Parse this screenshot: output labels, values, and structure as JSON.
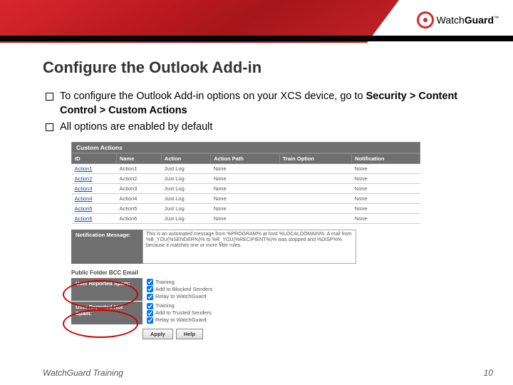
{
  "brand": {
    "pre": "Watch",
    "post": "Guard",
    "tm": "™"
  },
  "slide": {
    "title": "Configure the Outlook Add-in",
    "bullets": {
      "b1_pre": "To configure the Outlook Add-in options on your XCS device, go to ",
      "b1_bold": "Security > Content Control > Custom Actions",
      "b2": "All options are enabled by default"
    }
  },
  "panel": {
    "section_title": "Custom Actions",
    "headers": {
      "id": "ID",
      "name": "Name",
      "action": "Action",
      "path": "Action Path",
      "train": "Train Option",
      "notif": "Notification"
    },
    "rows": [
      {
        "id": "Action1",
        "name": "Action1",
        "action": "Just Log",
        "path": "None",
        "train": "",
        "notif": "None"
      },
      {
        "id": "Action2",
        "name": "Action2",
        "action": "Just Log",
        "path": "None",
        "train": "",
        "notif": "None"
      },
      {
        "id": "Action3",
        "name": "Action3",
        "action": "Just Log",
        "path": "None",
        "train": "",
        "notif": "None"
      },
      {
        "id": "Action4",
        "name": "Action4",
        "action": "Just Log",
        "path": "None",
        "train": "",
        "notif": "None"
      },
      {
        "id": "Action5",
        "name": "Action5",
        "action": "Just Log",
        "path": "None",
        "train": "",
        "notif": "None"
      },
      {
        "id": "Action6",
        "name": "Action6",
        "action": "Just Log",
        "path": "None",
        "train": "",
        "notif": "None"
      }
    ],
    "notif_label": "Notification Message:",
    "notif_text": "This is an automated message from %PROGRAM% at host %LOCALDOMAIN%.\n\nA mail from %B_YOU(%SENDER%)% to %R_YOU(%RECIPIENT%)% was stopped and %DISP%% because it matches one or more filter rules.",
    "section2": "Public Folder BCC Email",
    "row_spam": "User Reported Spam:",
    "row_notspam": "User Reported Not Spam:",
    "opts_spam": {
      "o1": "Training",
      "o2": "Add to Blocked Senders",
      "o3": "Relay to WatchGuard"
    },
    "opts_notspam": {
      "o1": "Training",
      "o2": "Add to Trusted Senders",
      "o3": "Relay to WatchGuard"
    },
    "btn_apply": "Apply",
    "btn_help": "Help"
  },
  "footer": {
    "left": "WatchGuard Training",
    "page": "10"
  }
}
